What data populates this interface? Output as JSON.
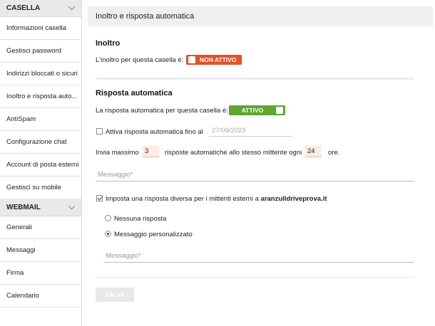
{
  "sidebar": {
    "casella_title": "CASELLA",
    "casella_items": [
      {
        "label": "Informazioni casella"
      },
      {
        "label": "Gestisci password"
      },
      {
        "label": "Indirizzi bloccati o sicuri"
      },
      {
        "label": "Inoltro e risposta auto..."
      },
      {
        "label": "AntiSpam"
      },
      {
        "label": "Configurazione chat"
      },
      {
        "label": "Account di posta esterni"
      },
      {
        "label": "Gestisci su mobile"
      }
    ],
    "webmail_title": "WEBMAIL",
    "webmail_items": [
      {
        "label": "Generali"
      },
      {
        "label": "Messaggi"
      },
      {
        "label": "Firma"
      },
      {
        "label": "Calendario"
      }
    ]
  },
  "main": {
    "title": "Inoltro e risposta automatica",
    "forward": {
      "heading": "Inoltro",
      "label": "L'inoltro per questa casella è:",
      "toggle_label": "NON ATTIVO"
    },
    "autoreply": {
      "heading": "Risposta automatica",
      "label": "La risposta automatica per questa casella è:",
      "toggle_label": "ATTIVO",
      "until_label": "Attiva risposta automatica fino al",
      "until_placeholder": "27/09/2023",
      "send_max_label": "Invia massimo",
      "max_value": "3",
      "middle_label": "risposte automatiche allo stesso mittente ogni",
      "hours_value": "24",
      "hours_label": "ore.",
      "message_placeholder": "Messaggio*",
      "external_label": "Imposta una risposta diversa per i mittenti esterni a",
      "external_domain": "aranzulldriveprova.it",
      "option_none": "Nessuna risposta",
      "option_custom": "Messaggio personalizzato",
      "external_message_placeholder": "Messaggio*"
    },
    "save_label": "SALVA"
  }
}
